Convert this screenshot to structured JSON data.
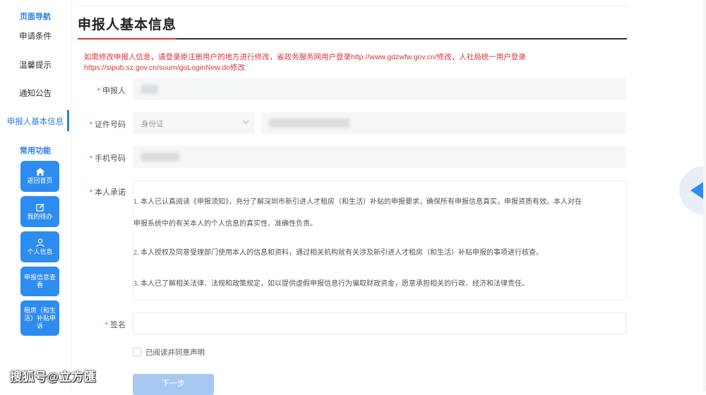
{
  "nav": {
    "section_title": "页面导航",
    "items": [
      {
        "label": "申请条件"
      },
      {
        "label": "温馨提示"
      },
      {
        "label": "通知公告"
      },
      {
        "label": "申报人基本信息"
      }
    ],
    "functions_title": "常用功能",
    "functions": [
      {
        "label": "返回首页",
        "icon": "home-icon"
      },
      {
        "label": "我的待办",
        "icon": "edit-icon"
      },
      {
        "label": "个人信息",
        "icon": "user-icon"
      },
      {
        "label": "申报信息查看",
        "icon": null
      },
      {
        "label": "租房（和生活）补贴申诉",
        "icon": null
      }
    ]
  },
  "main": {
    "title": "申报人基本信息",
    "notice_line1": "如需修改申报人信息，请登录原注册用户的地方进行修改，省政务服务网用户登录http://www.gdzwfw.gov.cn/修改，人社局统一用户登录",
    "notice_line2": "https://sipub.sz.gov.cn/suum/goLoginNew.do修改",
    "form": {
      "applicant_label": "申报人",
      "id_label": "证件号码",
      "id_type_value": "身份证",
      "phone_label": "手机号码",
      "pledge_label": "本人承诺",
      "pledge_items": [
        "1. 本人已认真阅读《申报须知》，充分了解深圳市新引进人才租房（和生活）补贴的申报要求，确保所有申报信息真实，申报资质有效。本人对在",
        "申报系统中的有关本人的个人信息的真实性、准确性负责。",
        "2. 本人授权及同意受理部门使用本人的信息和资料，通过相关机构就有关涉及新引进人才租房（和生活）补贴申报的事项进行核查。",
        "3. 本人已了解相关法律、法规和政策规定，如以提供虚假申报信息行为骗取财政资金，愿意承担相关的行政、经济和法律责任。"
      ],
      "signature_label": "签名",
      "agree_label": "已阅读并同意声明",
      "next_button": "下一步"
    }
  },
  "watermark": "搜狐号@立方匯",
  "colors": {
    "accent": "#2f7de1",
    "button": "#2d8cf0",
    "notice": "#d9343b",
    "disabled_button": "#a7c8f1"
  }
}
